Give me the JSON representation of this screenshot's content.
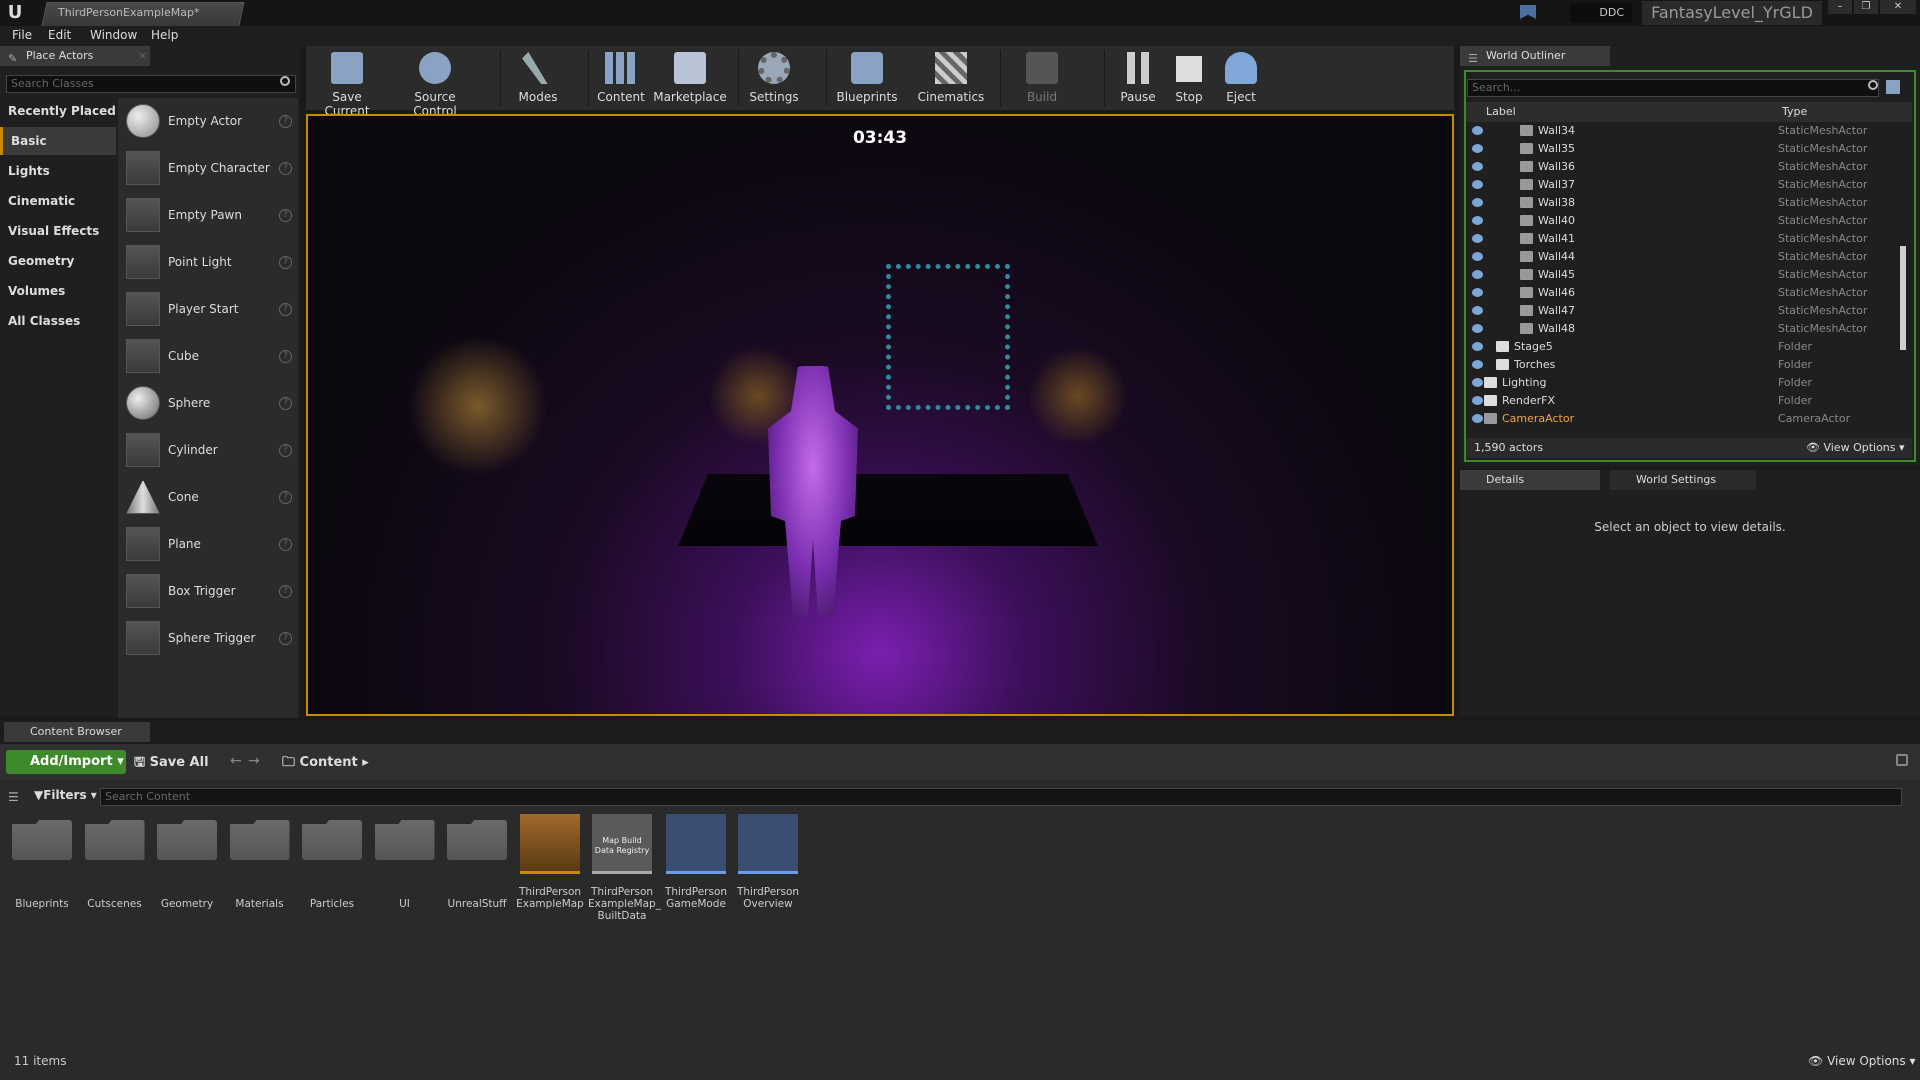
{
  "window": {
    "tab_title": "ThirdPersonExampleMap*",
    "ddc": "DDC",
    "project": "FantasyLevel_YrGLD"
  },
  "menu": [
    "File",
    "Edit",
    "Window",
    "Help"
  ],
  "place_actors": {
    "tab": "Place Actors",
    "search_placeholder": "Search Classes",
    "categories": [
      "Recently Placed",
      "Basic",
      "Lights",
      "Cinematic",
      "Visual Effects",
      "Geometry",
      "Volumes",
      "All Classes"
    ],
    "actors": [
      "Empty Actor",
      "Empty Character",
      "Empty Pawn",
      "Point Light",
      "Player Start",
      "Cube",
      "Sphere",
      "Cylinder",
      "Cone",
      "Plane",
      "Box Trigger",
      "Sphere Trigger"
    ]
  },
  "toolbar": [
    "Save Current",
    "Source Control",
    "Modes",
    "Content",
    "Marketplace",
    "Settings",
    "Blueprints",
    "Cinematics",
    "Build",
    "Pause",
    "Stop",
    "Eject"
  ],
  "viewport": {
    "timer": "03:43"
  },
  "outliner": {
    "tab": "World Outliner",
    "search_placeholder": "Search...",
    "col_label": "Label",
    "col_type": "Type",
    "rows": [
      {
        "label": "Wall34",
        "type": "StaticMeshActor"
      },
      {
        "label": "Wall35",
        "type": "StaticMeshActor"
      },
      {
        "label": "Wall36",
        "type": "StaticMeshActor"
      },
      {
        "label": "Wall37",
        "type": "StaticMeshActor"
      },
      {
        "label": "Wall38",
        "type": "StaticMeshActor"
      },
      {
        "label": "Wall40",
        "type": "StaticMeshActor"
      },
      {
        "label": "Wall41",
        "type": "StaticMeshActor"
      },
      {
        "label": "Wall44",
        "type": "StaticMeshActor"
      },
      {
        "label": "Wall45",
        "type": "StaticMeshActor"
      },
      {
        "label": "Wall46",
        "type": "StaticMeshActor"
      },
      {
        "label": "Wall47",
        "type": "StaticMeshActor"
      },
      {
        "label": "Wall48",
        "type": "StaticMeshActor"
      },
      {
        "label": "Stage5",
        "type": "Folder"
      },
      {
        "label": "Torches",
        "type": "Folder"
      },
      {
        "label": "Lighting",
        "type": "Folder"
      },
      {
        "label": "RenderFX",
        "type": "Folder"
      },
      {
        "label": "CameraActor",
        "type": "CameraActor"
      }
    ],
    "count": "1,590 actors",
    "view_options": "View Options"
  },
  "details": {
    "tab1": "Details",
    "tab2": "World Settings",
    "empty_msg": "Select an object to view details."
  },
  "content_browser": {
    "tab": "Content Browser",
    "add_import": "Add/Import",
    "save_all": "Save All",
    "path": "Content",
    "filters": "Filters",
    "search_placeholder": "Search Content",
    "folders": [
      "Blueprints",
      "Cutscenes",
      "Geometry",
      "Materials",
      "Particles",
      "UI",
      "UnrealStuff"
    ],
    "assets": [
      {
        "name": "ThirdPerson ExampleMap",
        "tile_text": ""
      },
      {
        "name": "ThirdPerson ExampleMap_ BuiltData",
        "tile_text": "Map Build Data Registry"
      },
      {
        "name": "ThirdPerson GameMode",
        "tile_text": ""
      },
      {
        "name": "ThirdPerson Overview",
        "tile_text": ""
      }
    ],
    "item_count": "11 items",
    "view_options": "View Options"
  },
  "colors": {
    "accent": "#c78a00",
    "add_button": "#3d8a2b",
    "glow": "#7a1fb0"
  }
}
